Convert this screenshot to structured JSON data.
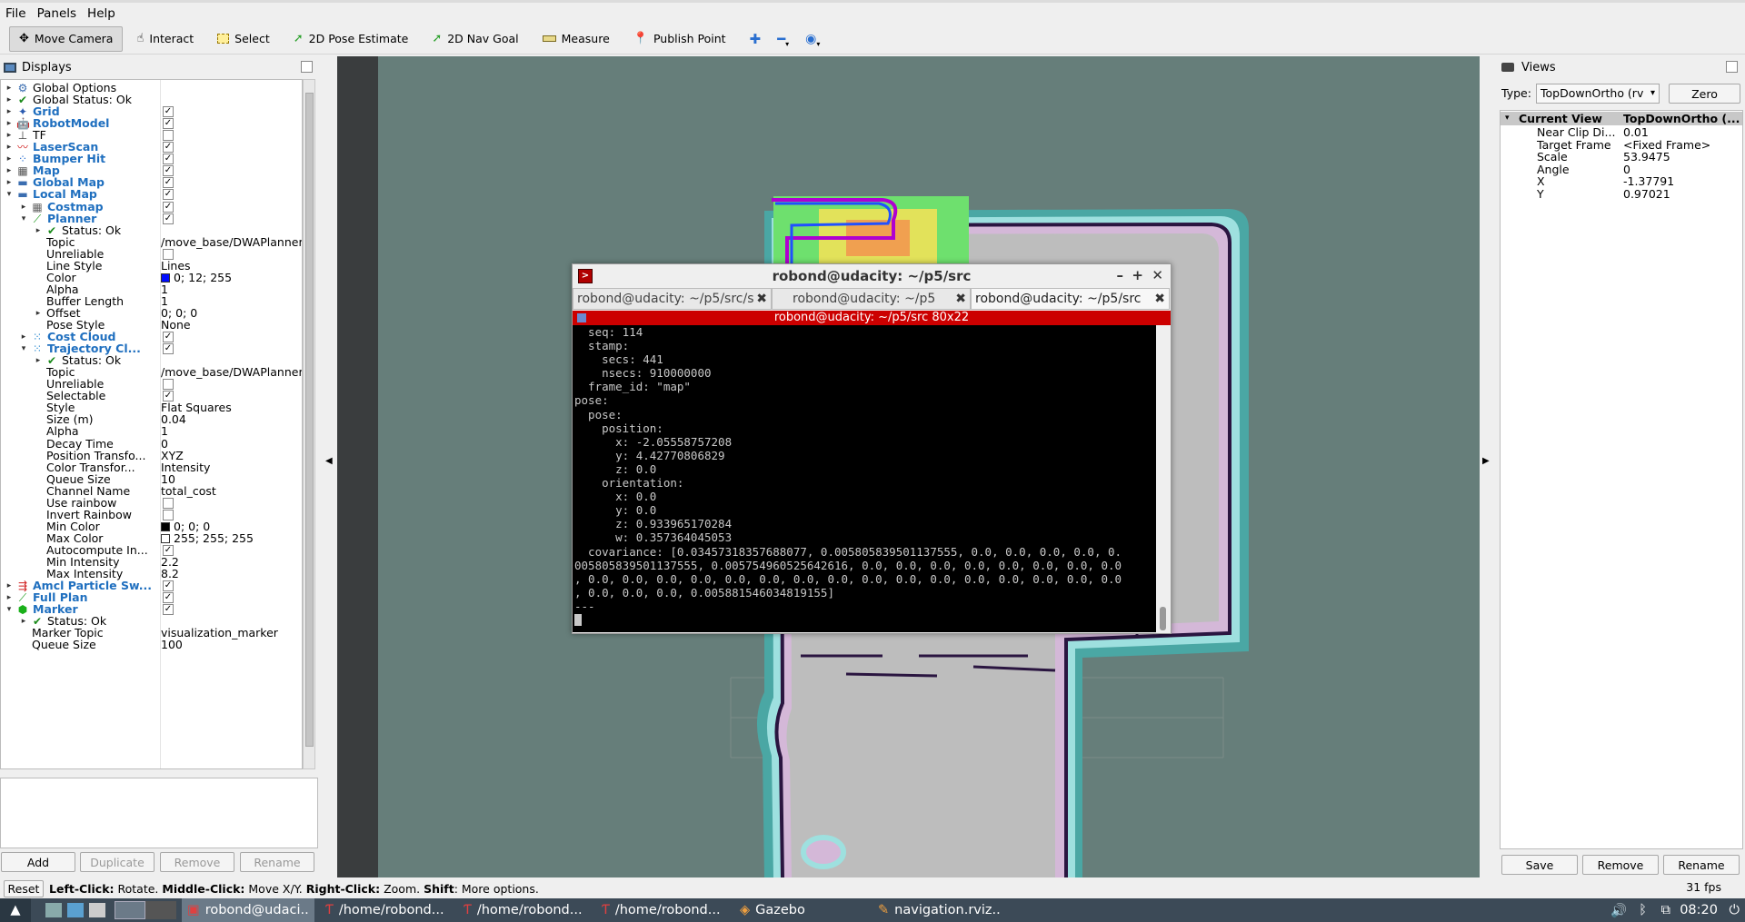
{
  "menubar": {
    "items": [
      "File",
      "Panels",
      "Help"
    ]
  },
  "toolbar": {
    "tools": [
      {
        "label": "Move Camera",
        "icon": "move-camera-icon",
        "active": true
      },
      {
        "label": "Interact",
        "icon": "hand-icon"
      },
      {
        "label": "Select",
        "icon": "select-icon"
      },
      {
        "label": "2D Pose Estimate",
        "icon": "pose-arrow-icon"
      },
      {
        "label": "2D Nav Goal",
        "icon": "goal-arrow-icon"
      },
      {
        "label": "Measure",
        "icon": "ruler-icon"
      },
      {
        "label": "Publish Point",
        "icon": "pin-icon"
      }
    ],
    "extra_icons": [
      "plus-icon",
      "minus-icon",
      "eye-icon"
    ]
  },
  "displays": {
    "title": "Displays",
    "rows": [
      {
        "arrow": "▸",
        "depth": 0,
        "icon": "gear-icon",
        "label": "Global Options",
        "bold": false,
        "value": ""
      },
      {
        "arrow": "▸",
        "depth": 0,
        "icon": "check-icon",
        "label": "Global Status: Ok",
        "bold": false,
        "value": ""
      },
      {
        "arrow": "▸",
        "depth": 0,
        "icon": "grid-icon",
        "label": "Grid",
        "bold": true,
        "check": true
      },
      {
        "arrow": "▸",
        "depth": 0,
        "icon": "robot-icon",
        "label": "RobotModel",
        "bold": true,
        "check": true
      },
      {
        "arrow": "▸",
        "depth": 0,
        "icon": "tf-icon",
        "label": "TF",
        "bold": false,
        "check": false
      },
      {
        "arrow": "▸",
        "depth": 0,
        "icon": "laser-icon",
        "label": "LaserScan",
        "bold": true,
        "check": true
      },
      {
        "arrow": "▸",
        "depth": 0,
        "icon": "bumper-icon",
        "label": "Bumper Hit",
        "bold": true,
        "check": true
      },
      {
        "arrow": "▸",
        "depth": 0,
        "icon": "map-icon",
        "label": "Map",
        "bold": true,
        "check": true
      },
      {
        "arrow": "▸",
        "depth": 0,
        "icon": "folder-icon",
        "label": "Global Map",
        "bold": true,
        "check": true
      },
      {
        "arrow": "▾",
        "depth": 0,
        "icon": "folder-icon",
        "label": "Local Map",
        "bold": true,
        "check": true
      },
      {
        "arrow": "▸",
        "depth": 1,
        "icon": "costmap-icon",
        "label": "Costmap",
        "bold": true,
        "check": true
      },
      {
        "arrow": "▾",
        "depth": 1,
        "icon": "path-icon",
        "label": "Planner",
        "bold": true,
        "check": true
      },
      {
        "arrow": "▸",
        "depth": 2,
        "icon": "check-icon",
        "label": "Status: Ok",
        "bold": false,
        "value": ""
      },
      {
        "arrow": "",
        "depth": 2,
        "icon": "",
        "label": "Topic",
        "bold": false,
        "value": "/move_base/DWAPlanner..."
      },
      {
        "arrow": "",
        "depth": 2,
        "icon": "",
        "label": "Unreliable",
        "bold": false,
        "check": false
      },
      {
        "arrow": "",
        "depth": 2,
        "icon": "",
        "label": "Line Style",
        "bold": false,
        "value": "Lines"
      },
      {
        "arrow": "",
        "depth": 2,
        "icon": "",
        "label": "Color",
        "bold": false,
        "value": "0; 12; 255",
        "swatch": "#000cff"
      },
      {
        "arrow": "",
        "depth": 2,
        "icon": "",
        "label": "Alpha",
        "bold": false,
        "value": "1"
      },
      {
        "arrow": "",
        "depth": 2,
        "icon": "",
        "label": "Buffer Length",
        "bold": false,
        "value": "1"
      },
      {
        "arrow": "▸",
        "depth": 2,
        "icon": "",
        "label": "Offset",
        "bold": false,
        "value": "0; 0; 0"
      },
      {
        "arrow": "",
        "depth": 2,
        "icon": "",
        "label": "Pose Style",
        "bold": false,
        "value": "None"
      },
      {
        "arrow": "▸",
        "depth": 1,
        "icon": "cloud-icon",
        "label": "Cost Cloud",
        "bold": true,
        "check": true
      },
      {
        "arrow": "▾",
        "depth": 1,
        "icon": "cloud-icon",
        "label": "Trajectory Cl...",
        "bold": true,
        "check": true
      },
      {
        "arrow": "▸",
        "depth": 2,
        "icon": "check-icon",
        "label": "Status: Ok",
        "bold": false,
        "value": ""
      },
      {
        "arrow": "",
        "depth": 2,
        "icon": "",
        "label": "Topic",
        "bold": false,
        "value": "/move_base/DWAPlanner..."
      },
      {
        "arrow": "",
        "depth": 2,
        "icon": "",
        "label": "Unreliable",
        "bold": false,
        "check": false
      },
      {
        "arrow": "",
        "depth": 2,
        "icon": "",
        "label": "Selectable",
        "bold": false,
        "check": true
      },
      {
        "arrow": "",
        "depth": 2,
        "icon": "",
        "label": "Style",
        "bold": false,
        "value": "Flat Squares"
      },
      {
        "arrow": "",
        "depth": 2,
        "icon": "",
        "label": "Size (m)",
        "bold": false,
        "value": "0.04"
      },
      {
        "arrow": "",
        "depth": 2,
        "icon": "",
        "label": "Alpha",
        "bold": false,
        "value": "1"
      },
      {
        "arrow": "",
        "depth": 2,
        "icon": "",
        "label": "Decay Time",
        "bold": false,
        "value": "0"
      },
      {
        "arrow": "",
        "depth": 2,
        "icon": "",
        "label": "Position Transfo...",
        "bold": false,
        "value": "XYZ"
      },
      {
        "arrow": "",
        "depth": 2,
        "icon": "",
        "label": "Color Transfor...",
        "bold": false,
        "value": "Intensity"
      },
      {
        "arrow": "",
        "depth": 2,
        "icon": "",
        "label": "Queue Size",
        "bold": false,
        "value": "10"
      },
      {
        "arrow": "",
        "depth": 2,
        "icon": "",
        "label": "Channel Name",
        "bold": false,
        "value": "total_cost"
      },
      {
        "arrow": "",
        "depth": 2,
        "icon": "",
        "label": "Use rainbow",
        "bold": false,
        "check": false
      },
      {
        "arrow": "",
        "depth": 2,
        "icon": "",
        "label": "Invert Rainbow",
        "bold": false,
        "check": false
      },
      {
        "arrow": "",
        "depth": 2,
        "icon": "",
        "label": "Min Color",
        "bold": false,
        "value": "0; 0; 0",
        "swatch": "#000000"
      },
      {
        "arrow": "",
        "depth": 2,
        "icon": "",
        "label": "Max Color",
        "bold": false,
        "value": "255; 255; 255",
        "swatch": "#ffffff"
      },
      {
        "arrow": "",
        "depth": 2,
        "icon": "",
        "label": "Autocompute In...",
        "bold": false,
        "check": true
      },
      {
        "arrow": "",
        "depth": 2,
        "icon": "",
        "label": "Min Intensity",
        "bold": false,
        "value": "2.2"
      },
      {
        "arrow": "",
        "depth": 2,
        "icon": "",
        "label": "Max Intensity",
        "bold": false,
        "value": "8.2"
      },
      {
        "arrow": "▸",
        "depth": 0,
        "icon": "particle-icon",
        "label": "Amcl Particle Sw...",
        "bold": true,
        "check": true
      },
      {
        "arrow": "▸",
        "depth": 0,
        "icon": "path-icon",
        "label": "Full Plan",
        "bold": true,
        "check": true
      },
      {
        "arrow": "▾",
        "depth": 0,
        "icon": "marker-icon",
        "label": "Marker",
        "bold": true,
        "check": true
      },
      {
        "arrow": "▸",
        "depth": 1,
        "icon": "check-icon",
        "label": "Status: Ok",
        "bold": false,
        "value": ""
      },
      {
        "arrow": "",
        "depth": 1,
        "icon": "",
        "label": "Marker Topic",
        "bold": false,
        "value": "visualization_marker"
      },
      {
        "arrow": "",
        "depth": 1,
        "icon": "",
        "label": "Queue Size",
        "bold": false,
        "value": "100"
      }
    ],
    "buttons": {
      "add": "Add",
      "duplicate": "Duplicate",
      "remove": "Remove",
      "rename": "Rename"
    }
  },
  "views": {
    "title": "Views",
    "type_label": "Type:",
    "type_value": "TopDownOrtho (rv",
    "zero_label": "Zero",
    "current_view_label": "Current View",
    "current_view_value": "TopDownOrtho (...",
    "props": [
      {
        "label": "Near Clip Di...",
        "value": "0.01"
      },
      {
        "label": "Target Frame",
        "value": "<Fixed Frame>"
      },
      {
        "label": "Scale",
        "value": "53.9475"
      },
      {
        "label": "Angle",
        "value": "0"
      },
      {
        "label": "X",
        "value": "-1.37791"
      },
      {
        "label": "Y",
        "value": "0.97021"
      }
    ],
    "buttons": {
      "save": "Save",
      "remove": "Remove",
      "rename": "Rename"
    }
  },
  "terminal": {
    "title": "robond@udacity: ~/p5/src",
    "tabs": [
      "robond@udacity: ~/p5/src/s",
      "robond@udacity: ~/p5",
      "robond@udacity: ~/p5/src"
    ],
    "subtitle": "robond@udacity: ~/p5/src 80x22",
    "lines": [
      "  seq: 114",
      "  stamp:",
      "    secs: 441",
      "    nsecs: 910000000",
      "  frame_id: \"map\"",
      "pose:",
      "  pose:",
      "    position:",
      "      x: -2.05558757208",
      "      y: 4.42770806829",
      "      z: 0.0",
      "    orientation:",
      "      x: 0.0",
      "      y: 0.0",
      "      z: 0.933965170284",
      "      w: 0.357364045053",
      "  covariance: [0.03457318357688077, 0.005805839501137555, 0.0, 0.0, 0.0, 0.0, 0.",
      "005805839501137555, 0.005754960525642616, 0.0, 0.0, 0.0, 0.0, 0.0, 0.0, 0.0, 0.0",
      ", 0.0, 0.0, 0.0, 0.0, 0.0, 0.0, 0.0, 0.0, 0.0, 0.0, 0.0, 0.0, 0.0, 0.0, 0.0, 0.0",
      ", 0.0, 0.0, 0.0, 0.005881546034819155]",
      "---",
      ""
    ]
  },
  "statusbar": {
    "reset": "Reset",
    "hint_parts": [
      {
        "b": "Left-Click:",
        "t": " Rotate. "
      },
      {
        "b": "Middle-Click:",
        "t": " Move X/Y. "
      },
      {
        "b": "Right-Click:",
        "t": ": Zoom. "
      },
      {
        "b": "Shift",
        "t": ": More options."
      }
    ],
    "fps": "31 fps"
  },
  "taskbar": {
    "tasks": [
      {
        "label": "robond@udaci...",
        "icon": "terminal-icon",
        "selected": true
      },
      {
        "label": "/home/robond...",
        "icon": "text-editor-icon"
      },
      {
        "label": "/home/robond...",
        "icon": "text-editor-icon"
      },
      {
        "label": "/home/robond...",
        "icon": "text-editor-icon"
      },
      {
        "label": "Gazebo",
        "icon": "gazebo-icon"
      },
      {
        "label": "navigation.rviz...",
        "icon": "rviz-icon"
      }
    ],
    "clock": "08:20"
  }
}
